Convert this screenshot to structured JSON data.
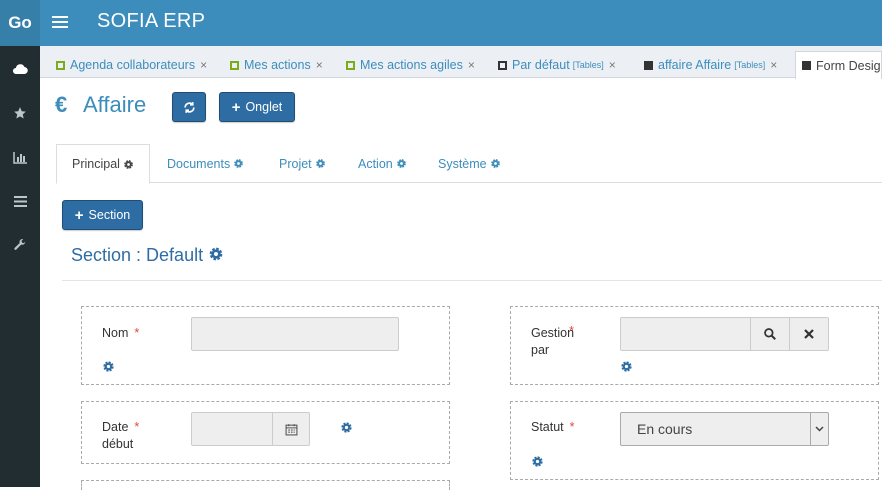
{
  "app": {
    "logo": "Go",
    "title": "SOFIA ERP"
  },
  "sidebar": {
    "items": [
      "cloud-icon",
      "star-icon",
      "chart-icon",
      "list-icon",
      "wrench-icon"
    ]
  },
  "tabs": [
    {
      "label": "Agenda collaborateurs",
      "suffix": "",
      "close": "×"
    },
    {
      "label": "Mes actions",
      "suffix": "",
      "close": "×"
    },
    {
      "label": "Mes actions agiles",
      "suffix": "",
      "close": "×"
    },
    {
      "label": "Par défaut",
      "suffix": "[Tables]",
      "close": "×"
    },
    {
      "label": "affaire Affaire",
      "suffix": "[Tables]",
      "close": "×"
    },
    {
      "label": "Form Design",
      "suffix": "",
      "close": ""
    }
  ],
  "page": {
    "icon": "€",
    "title": "Affaire",
    "onglet_label": "Onglet",
    "section_button": "Section"
  },
  "inner_tabs": [
    {
      "label": "Principal"
    },
    {
      "label": "Documents"
    },
    {
      "label": "Projet"
    },
    {
      "label": "Action"
    },
    {
      "label": "Système"
    }
  ],
  "section": {
    "title": "Section : Default"
  },
  "fields": {
    "nom": {
      "label": "Nom",
      "required": "*",
      "value": ""
    },
    "gestion": {
      "label_line1": "Gestion",
      "label_line2": "par",
      "required": "*",
      "value": ""
    },
    "date_debut": {
      "label_line1": "Date",
      "label_line2": "début",
      "required": "*",
      "value": ""
    },
    "statut": {
      "label": "Statut",
      "required": "*",
      "selected": "En cours"
    }
  },
  "colors": {
    "topbar": "#3c8dbc",
    "sidebar": "#222d32",
    "accent": "#2e6da4",
    "required": "#dd4b39"
  }
}
